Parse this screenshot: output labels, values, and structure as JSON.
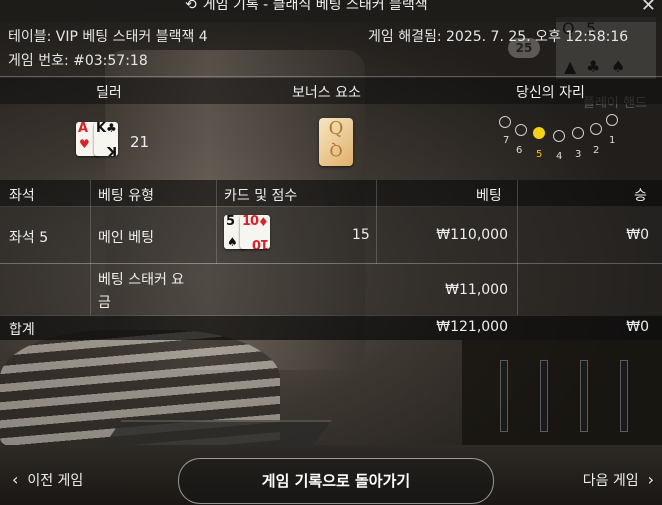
{
  "title": "게임 기록 - 클래식 베팅 스태커 블랙잭",
  "info": {
    "table": "테이블: VIP 베팅 스태커 블랙잭 4",
    "game_number": "게임 번호: #03:57:18",
    "resolved": "게임 해결됨: 2025. 7. 25. 오후 12:58:16"
  },
  "background": {
    "badge": "25",
    "hint_label": "플레이 핸드"
  },
  "hand": {
    "dealer_label": "딜러",
    "bonus_label": "보너스 요소",
    "seat_label": "당신의 자리",
    "dealer_score": "21",
    "dealer_cards": [
      {
        "rank": "A",
        "suit": "♥",
        "color": "#d8232a"
      },
      {
        "rank": "K",
        "suit": "♣",
        "color": "#111111"
      }
    ],
    "bonus_card": {
      "rank": "Q"
    },
    "seats": [
      "7",
      "6",
      "5",
      "4",
      "3",
      "2",
      "1"
    ],
    "active_seat": "5"
  },
  "bets": {
    "headers": {
      "seat": "좌석",
      "bet_type": "베팅 유형",
      "cards_score": "카드 및 점수",
      "bet": "베팅",
      "win": "승"
    },
    "rows": [
      {
        "seat": "좌석 5",
        "bet_type": "메인 베팅",
        "score": "15",
        "bet": "₩110,000",
        "win": "₩0",
        "cards": [
          {
            "rank": "5",
            "suit": "♠",
            "color": "#111111"
          },
          {
            "rank": "10",
            "suit": "♦",
            "color": "#d8232a"
          }
        ]
      },
      {
        "seat": "",
        "bet_type_line1": "베팅 스태커 요",
        "bet_type_line2": "금",
        "bet": "₩11,000",
        "win": ""
      }
    ],
    "total_label": "합계",
    "total_bet": "₩121,000",
    "total_win": "₩0"
  },
  "footer": {
    "prev": "이전 게임",
    "back": "게임 기록으로 돌아가기",
    "next": "다음 게임"
  },
  "colors": {
    "active_seat": "#f2d21b",
    "red_suit": "#d8232a"
  }
}
